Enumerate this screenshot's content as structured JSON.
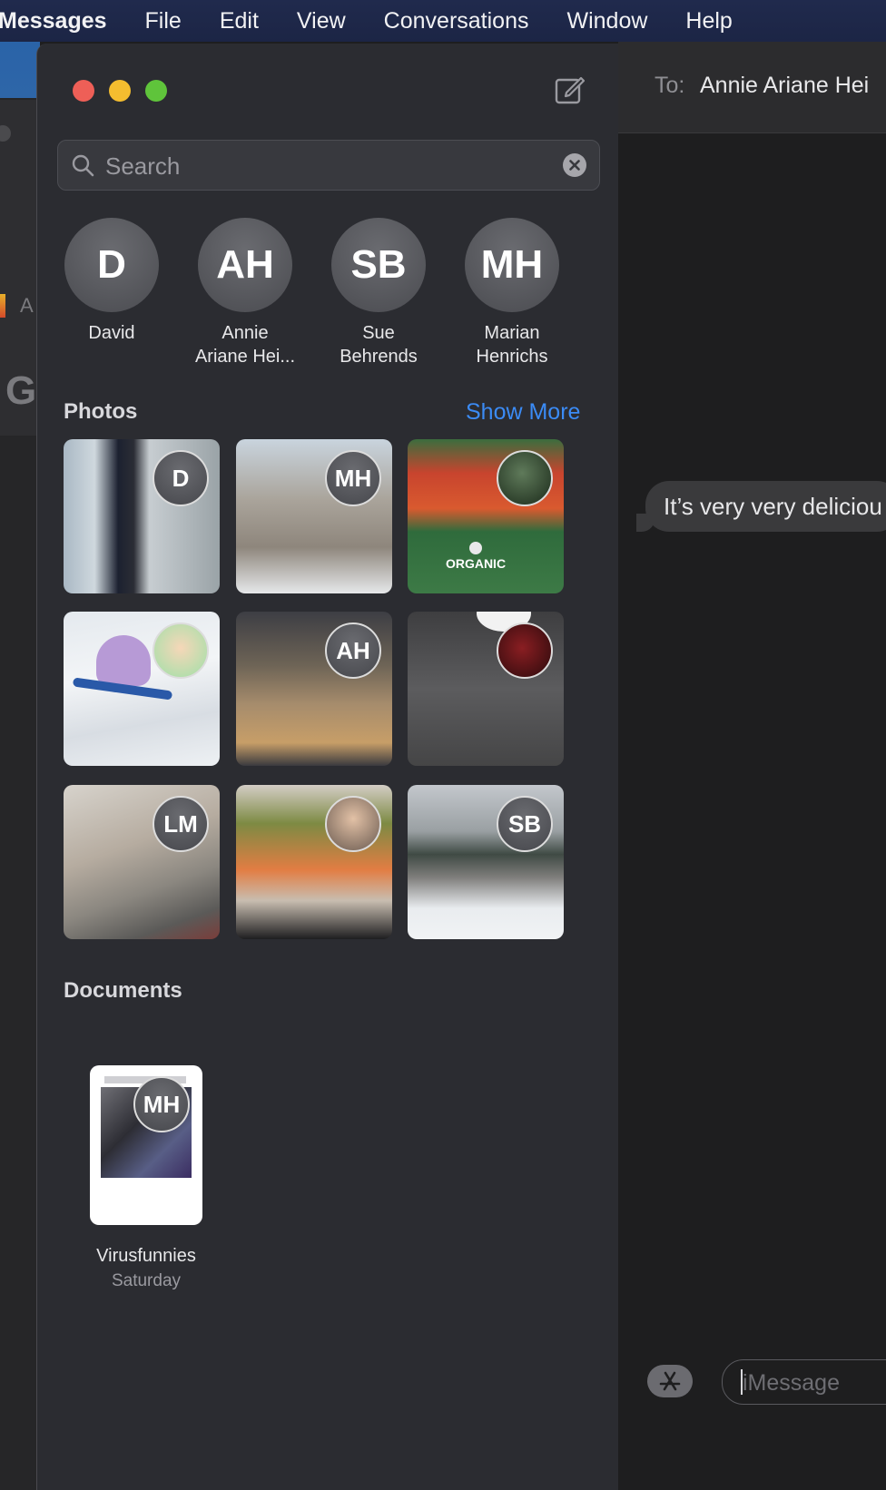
{
  "menu_bar": {
    "items": [
      "Messages",
      "File",
      "Edit",
      "View",
      "Conversations",
      "Window",
      "Help"
    ]
  },
  "background_window": {
    "partial_text": "A",
    "logo_letter": "G"
  },
  "sidebar": {
    "search": {
      "placeholder": "Search",
      "value": ""
    },
    "pinned": [
      {
        "initials": "D",
        "name_line1": "David",
        "name_line2": ""
      },
      {
        "initials": "AH",
        "name_line1": "Annie",
        "name_line2": "Ariane Hei..."
      },
      {
        "initials": "SB",
        "name_line1": "Sue",
        "name_line2": "Behrends"
      },
      {
        "initials": "MH",
        "name_line1": "Marian",
        "name_line2": "Henrichs"
      }
    ],
    "photos_title": "Photos",
    "show_more": "Show More",
    "photos": [
      {
        "badge": "D"
      },
      {
        "badge": "MH"
      },
      {
        "badge": ""
      },
      {
        "badge": ""
      },
      {
        "badge": "AH"
      },
      {
        "badge": ""
      },
      {
        "badge": "LM"
      },
      {
        "badge": ""
      },
      {
        "badge": "SB"
      }
    ],
    "photo_text": {
      "organic": "ORGANIC"
    },
    "documents_title": "Documents",
    "documents": [
      {
        "badge": "MH",
        "name": "Virusfunnies",
        "date": "Saturday"
      }
    ]
  },
  "conversation": {
    "to_label": "To:",
    "to_name": "Annie Ariane Hei",
    "messages": [
      {
        "text": "It’s very very deliciou"
      }
    ],
    "input_placeholder": "iMessage"
  },
  "colors": {
    "menu_bar": "#1f284b",
    "sidebar_bg": "#2b2c31",
    "link_blue": "#3b8bf5",
    "close": "#ee5f57",
    "minimize": "#f4bd2f",
    "zoom": "#5fc43b"
  }
}
